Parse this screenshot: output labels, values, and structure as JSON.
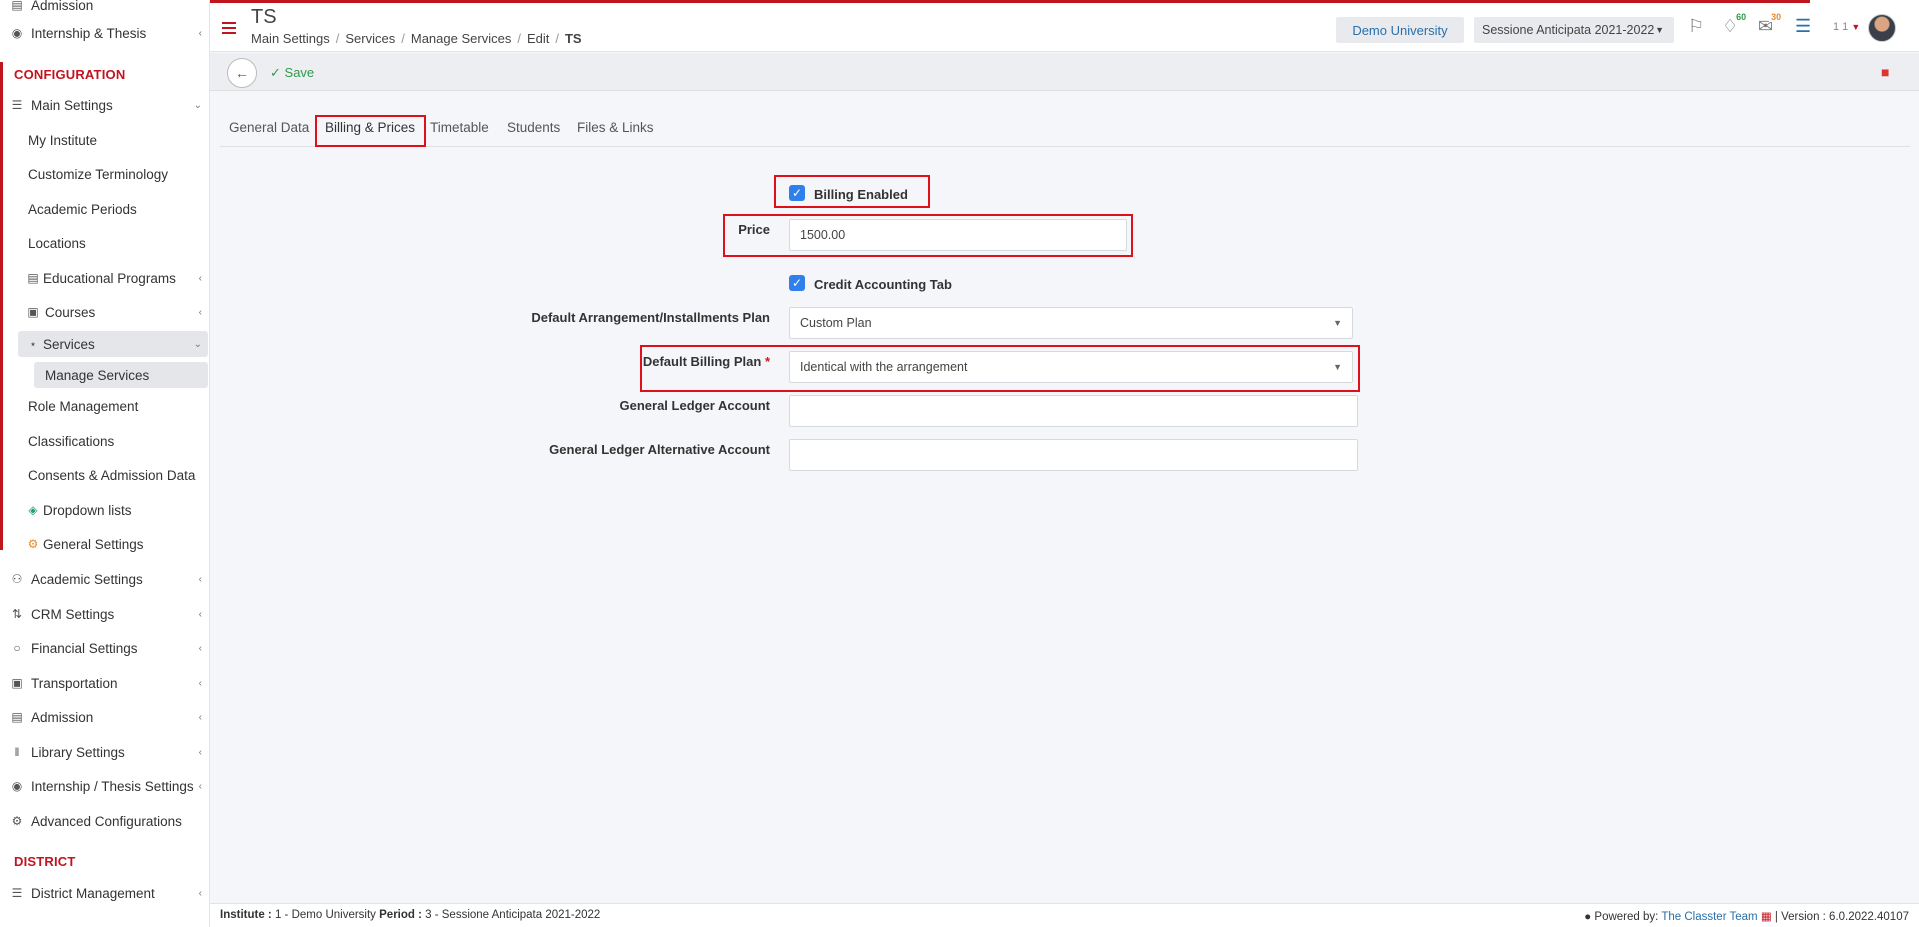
{
  "sidebar": {
    "top_partial": "Admission",
    "internship_thesis": "Internship & Thesis",
    "section_configuration": "CONFIGURATION",
    "main_settings": "Main Settings",
    "sub_items": [
      "My Institute",
      "Customize Terminology",
      "Academic Periods",
      "Locations"
    ],
    "educational_programs": "Educational Programs",
    "courses": "Courses",
    "services": "Services",
    "manage_services": "Manage Services",
    "after_items": [
      "Role Management",
      "Classifications",
      "Consents & Admission Data"
    ],
    "dropdown_lists": "Dropdown lists",
    "general_settings": "General Settings",
    "groups": [
      "Academic Settings",
      "CRM Settings",
      "Financial Settings",
      "Transportation",
      "Admission",
      "Library Settings",
      "Internship / Thesis Settings",
      "Advanced Configurations"
    ],
    "section_district": "DISTRICT",
    "district_management": "District Management"
  },
  "header": {
    "title": "TS",
    "breadcrumb": [
      "Main Settings",
      "Services",
      "Manage Services",
      "Edit",
      "TS"
    ],
    "institute_button": "Demo University",
    "period_select": "Sessione Anticipata 2021-2022",
    "notifications_count": "60",
    "messages_count": "30",
    "user_count": "1 1"
  },
  "toolbar": {
    "save_label": "Save"
  },
  "tabs": [
    "General Data",
    "Billing & Prices",
    "Timetable",
    "Students",
    "Files & Links"
  ],
  "form": {
    "billing_enabled_label": "Billing Enabled",
    "billing_enabled": true,
    "price_label": "Price",
    "price_value": "1500.00",
    "credit_accounting_label": "Credit Accounting Tab",
    "credit_accounting": true,
    "arrangement_label": "Default Arrangement/Installments Plan",
    "arrangement_value": "Custom Plan",
    "billing_plan_label": "Default Billing Plan",
    "billing_plan_required": "*",
    "billing_plan_value": "Identical with the arrangement",
    "gl_account_label": "General Ledger Account",
    "gl_account_value": "",
    "gl_alt_account_label": "General Ledger Alternative Account",
    "gl_alt_account_value": ""
  },
  "footer": {
    "institute_label": "Institute :",
    "institute_value": "1 - Demo University",
    "period_label": "Period :",
    "period_value": "3 - Sessione Anticipata 2021-2022",
    "powered_by": "Powered by:",
    "team": "The Classter Team",
    "version": "| Version : 6.0.2022.40107"
  },
  "colors": {
    "accent_red": "#c0141f",
    "highlight_red": "#e0101a",
    "checkbox_blue": "#2f80ed",
    "save_green": "#2e9b4a",
    "link_blue": "#2a6fa8"
  }
}
